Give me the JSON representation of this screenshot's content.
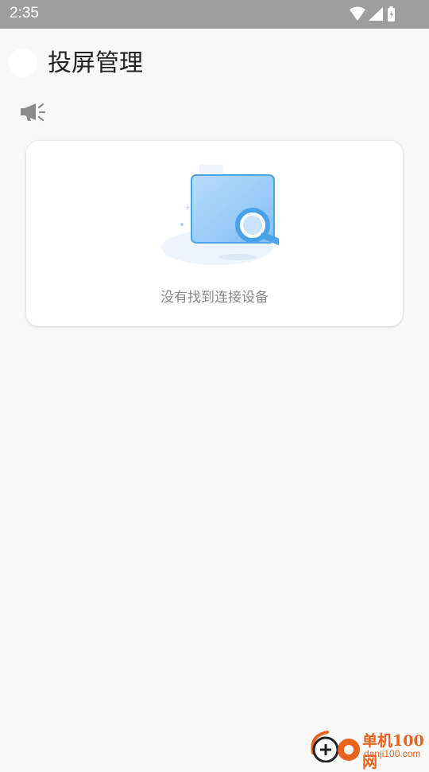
{
  "status_bar": {
    "time": "2:35",
    "icons": [
      "wifi-icon",
      "signal-icon",
      "battery-icon"
    ],
    "background": "#9e9e9e"
  },
  "header": {
    "title": "投屏管理",
    "back_icon": "back-icon"
  },
  "notice": {
    "icon": "megaphone-icon"
  },
  "device_card": {
    "empty_text": "没有找到连接设备",
    "illustration": "search-screen-illustration"
  },
  "watermark": {
    "name": "单机100网",
    "url": "danji100.com",
    "color": "#e8641e"
  },
  "colors": {
    "background": "#f9f9f9",
    "accent_blue": "#4aa3e8",
    "card": "#ffffff"
  }
}
